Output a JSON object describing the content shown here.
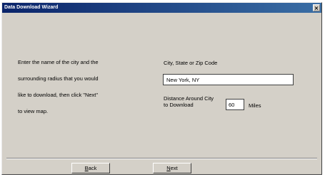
{
  "window": {
    "title": "Data Download Wizard",
    "close_glyph": "×"
  },
  "instructions": {
    "line1": "Enter the name of the city and the",
    "line2": "surrounding radius that you would",
    "line3": "like to download, then click \"Next\"",
    "line4": "to view map."
  },
  "location": {
    "label": "City, State or Zip Code",
    "value": "New York, NY"
  },
  "distance": {
    "label_line1": "Distance Around City",
    "label_line2": "to Download",
    "value": "60",
    "unit": "Miles"
  },
  "buttons": {
    "back_first": "B",
    "back_rest": "ack",
    "next_first": "N",
    "next_rest": "ext"
  }
}
